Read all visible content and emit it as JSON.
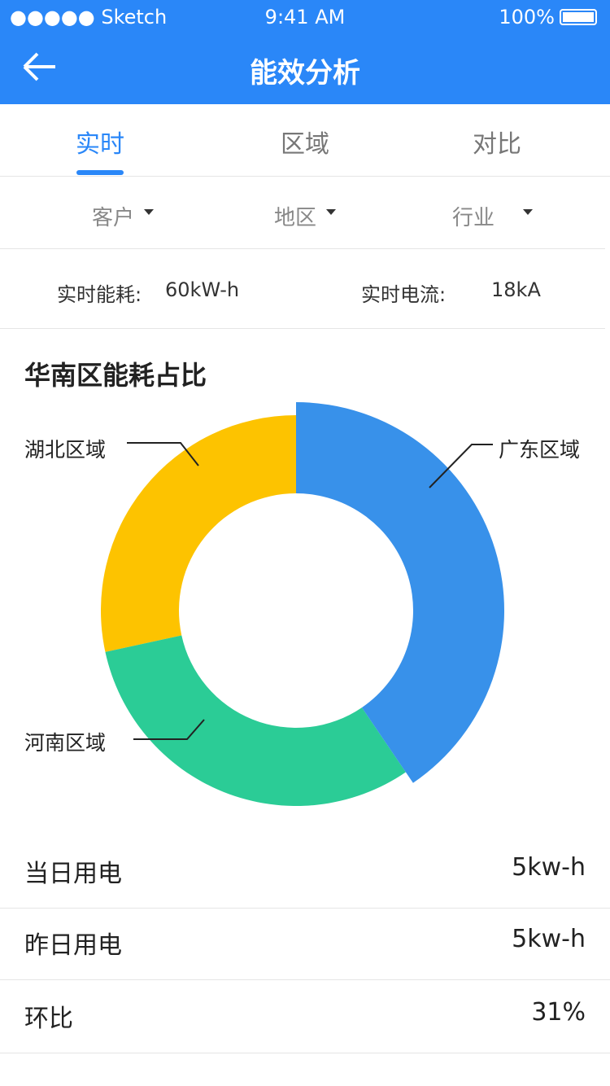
{
  "status_bar": {
    "carrier": "●●●●● Sketch",
    "time": "9:41 AM",
    "battery": "100%"
  },
  "header": {
    "title": "能效分析",
    "back_icon": "arrow-left-icon"
  },
  "tabs": [
    {
      "label": "实时",
      "active": true
    },
    {
      "label": "区域",
      "active": false
    },
    {
      "label": "对比",
      "active": false
    }
  ],
  "filters": [
    {
      "label": "客户"
    },
    {
      "label": "地区"
    },
    {
      "label": "行业"
    }
  ],
  "stats": {
    "energy_label": "实时能耗:",
    "energy_value": "60kW-h",
    "current_label": "实时电流:",
    "current_value": "18kA"
  },
  "chart_data": {
    "type": "pie",
    "title": "华南区能耗占比",
    "donut": true,
    "slices": [
      {
        "name": "广东区域",
        "value": 40.5,
        "color": "#3891ea"
      },
      {
        "name": "河南区域",
        "value": 31.1,
        "color": "#2bcc96"
      },
      {
        "name": "湖北区域",
        "value": 28.4,
        "color": "#fdc300"
      }
    ]
  },
  "rows": [
    {
      "label": "当日用电",
      "value": "5kw-h"
    },
    {
      "label": "昨日用电",
      "value": "5kw-h"
    },
    {
      "label": "环比",
      "value": "31%"
    }
  ]
}
